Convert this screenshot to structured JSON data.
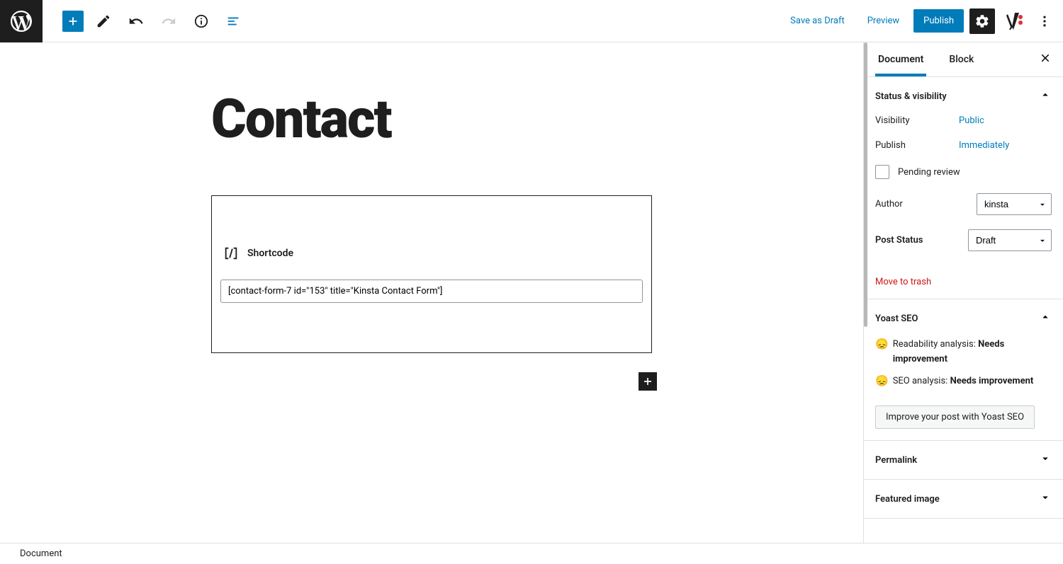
{
  "topbar": {
    "save_draft": "Save as Draft",
    "preview": "Preview",
    "publish": "Publish"
  },
  "page": {
    "title": "Contact",
    "block_label": "Shortcode",
    "shortcode_value": "[contact-form-7 id=\"153\" title=\"Kinsta Contact Form\"]"
  },
  "sidebar": {
    "tabs": {
      "document": "Document",
      "block": "Block"
    },
    "status": {
      "heading": "Status & visibility",
      "visibility_label": "Visibility",
      "visibility_value": "Public",
      "publish_label": "Publish",
      "publish_value": "Immediately",
      "pending": "Pending review",
      "author_label": "Author",
      "author_value": "kinsta",
      "post_status_label": "Post Status",
      "post_status_value": "Draft",
      "trash": "Move to trash"
    },
    "yoast": {
      "heading": "Yoast SEO",
      "readability_label": "Readability analysis: ",
      "readability_value": "Needs improvement",
      "seo_label": "SEO analysis: ",
      "seo_value": "Needs improvement",
      "improve_btn": "Improve your post with Yoast SEO"
    },
    "permalink": "Permalink",
    "featured": "Featured image"
  },
  "footer": {
    "breadcrumb": "Document"
  }
}
